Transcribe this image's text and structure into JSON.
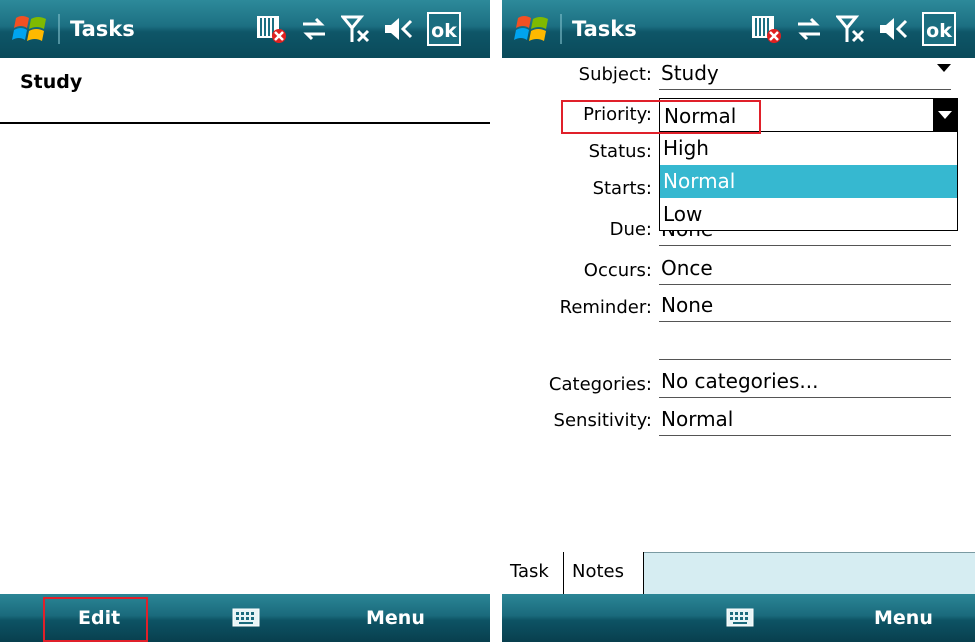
{
  "left": {
    "title": "Tasks",
    "ok_label": "ok",
    "task_item": "Study",
    "softkey_left": "Edit",
    "softkey_right": "Menu"
  },
  "right": {
    "title": "Tasks",
    "ok_label": "ok",
    "fields": {
      "subject": {
        "label": "Subject:",
        "value": "Study"
      },
      "priority": {
        "label": "Priority:",
        "value": "Normal"
      },
      "status": {
        "label": "Status:"
      },
      "starts": {
        "label": "Starts:"
      },
      "due": {
        "label": "Due:",
        "value": "None"
      },
      "occurs": {
        "label": "Occurs:",
        "value": "Once"
      },
      "reminder": {
        "label": "Reminder:",
        "value": "None"
      },
      "categories": {
        "label": "Categories:",
        "value": "No categories..."
      },
      "sensitivity": {
        "label": "Sensitivity:",
        "value": "Normal"
      }
    },
    "priority_options": [
      "High",
      "Normal",
      "Low"
    ],
    "tabs": [
      "Task",
      "Notes"
    ],
    "softkey_right": "Menu"
  },
  "icons": [
    "windows-start-icon",
    "sim-card-icon",
    "sync-arrows-icon",
    "no-signal-icon",
    "speaker-icon",
    "keyboard-icon"
  ],
  "colors": {
    "titlebar": "#1c6f82",
    "selection": "#36b8d0",
    "highlight_box": "#e0202a"
  }
}
